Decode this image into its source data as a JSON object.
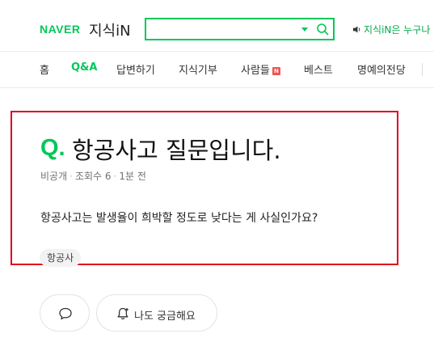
{
  "header": {
    "logo": "NAVER",
    "service_name": "지식iN",
    "search": {
      "value": "",
      "placeholder": ""
    },
    "notice": "지식iN은 누구나"
  },
  "nav": {
    "items": [
      {
        "label": "홈",
        "active": false
      },
      {
        "label": "Q&A",
        "active": true
      },
      {
        "label": "답변하기",
        "active": false
      },
      {
        "label": "지식기부",
        "active": false
      },
      {
        "label": "사람들",
        "active": false,
        "badge": "N"
      },
      {
        "label": "베스트",
        "active": false
      },
      {
        "label": "명예의전당",
        "active": false
      }
    ]
  },
  "question": {
    "q_mark": "Q.",
    "title": "항공사고 질문입니다.",
    "meta": {
      "author": "비공개",
      "views": "조회수 6",
      "time": "1분 전"
    },
    "body": "항공사고는 발생율이 희박할 정도로 낮다는 게 사실인가요?",
    "tag": "항공사"
  },
  "actions": {
    "curious_label": "나도 궁금해요"
  },
  "colors": {
    "brand_green": "#03c75a",
    "highlight_red": "#e0001b",
    "new_badge": "#f0544f"
  },
  "icons": [
    "search-icon",
    "speaker-icon",
    "comment-icon",
    "bell-icon"
  ]
}
